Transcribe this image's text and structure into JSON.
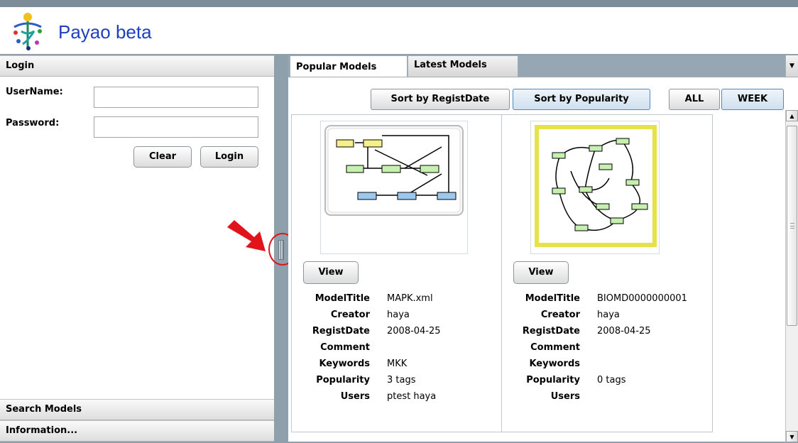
{
  "app": {
    "title": "Payao beta",
    "logo_icon": "payao-logo-icon"
  },
  "sidebar": {
    "login_header": "Login",
    "username_label": "UserName:",
    "password_label": "Password:",
    "username_value": "",
    "password_value": "",
    "clear_label": "Clear",
    "login_label": "Login",
    "search_header": "Search Models",
    "info_header": "Information..."
  },
  "tabs": [
    {
      "label": "Popular Models",
      "active": true
    },
    {
      "label": "Latest Models",
      "active": false
    }
  ],
  "sort": {
    "by_regist_date": "Sort by RegistDate",
    "by_popularity": "Sort by Popularity",
    "selected": "Sort by Popularity"
  },
  "period": {
    "all": "ALL",
    "week": "WEEK",
    "selected": "WEEK"
  },
  "view_label": "View",
  "field_labels": {
    "model_title": "ModelTitle",
    "creator": "Creator",
    "regist_date": "RegistDate",
    "comment": "Comment",
    "keywords": "Keywords",
    "popularity": "Popularity",
    "users": "Users"
  },
  "models": [
    {
      "model_title": "MAPK.xml",
      "creator": "haya",
      "regist_date": "2008-04-25",
      "comment": "",
      "keywords": "MKK",
      "popularity": "3 tags",
      "users": "ptest haya"
    },
    {
      "model_title": "BIOMD0000000001",
      "creator": "haya",
      "regist_date": "2008-04-25",
      "comment": "",
      "keywords": "",
      "popularity": "0 tags",
      "users": ""
    }
  ],
  "colors": {
    "title_blue": "#1f3fbf",
    "annotation_red": "#e0141a",
    "selected_border": "#4a88c6",
    "frame_gray": "#8fa0ad"
  }
}
